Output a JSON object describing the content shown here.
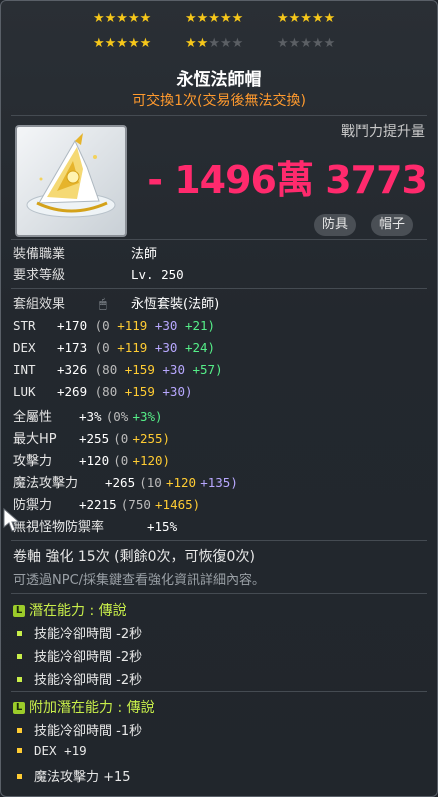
{
  "stars": {
    "groups": [
      {
        "on": 5,
        "off": 0
      },
      {
        "on": 5,
        "off": 0
      },
      {
        "on": 5,
        "off": 0
      },
      {
        "on": 5,
        "off": 0
      },
      {
        "on": 2,
        "off": 3
      },
      {
        "on": 0,
        "off": 5
      }
    ]
  },
  "item": {
    "name": "永恆法師帽",
    "trade_note": "可交換1次(交易後無法交換)",
    "cp_label": "戰鬥力提升量",
    "cp_value": "- 1496萬 3773",
    "tags": [
      "防具",
      "帽子"
    ]
  },
  "requirements": [
    {
      "label": "裝備職業",
      "value": "法師"
    },
    {
      "label": "要求等級",
      "value": "Lv. 250"
    }
  ],
  "set": {
    "label": "套組效果",
    "value": "永恆套裝(法師)"
  },
  "stats": [
    {
      "name": "STR",
      "total": "+170",
      "base": "(0",
      "scroll": "+119",
      "flame": "+30",
      "star": "+21)"
    },
    {
      "name": "DEX",
      "total": "+173",
      "base": "(0",
      "scroll": "+119",
      "flame": "+30",
      "star": "+24)"
    },
    {
      "name": "INT",
      "total": "+326",
      "base": "(80",
      "scroll": "+159",
      "flame": "+30",
      "star": "+57)"
    },
    {
      "name": "LUK",
      "total": "+269",
      "base": "(80",
      "scroll": "+159",
      "flame": "+30)",
      "star": ""
    }
  ],
  "stats2": [
    {
      "name": "全屬性",
      "total": "+3%",
      "base": "(0%",
      "a": "+3%)",
      "a_color": "g",
      "b": ""
    },
    {
      "name": "最大HP",
      "total": "+255",
      "base": "(0",
      "a": "+255)",
      "a_color": "y",
      "b": ""
    },
    {
      "name": "攻擊力",
      "total": "+120",
      "base": "(0",
      "a": "+120)",
      "a_color": "y",
      "b": ""
    },
    {
      "name": "魔法攻擊力",
      "total": "+265",
      "base": "(10",
      "a": "+120",
      "a_color": "y",
      "b": "+135)"
    },
    {
      "name": "防禦力",
      "total": "+2215",
      "base": "(750",
      "a": "+1465)",
      "a_color": "y",
      "b": ""
    },
    {
      "name": "無視怪物防禦率",
      "total": "+15%",
      "base": "",
      "a": "",
      "a_color": "y",
      "b": ""
    }
  ],
  "scroll_line": "卷軸 強化 15次 (剩餘0次，可恢復0次)",
  "hint_line": "可透過NPC/採集鍵查看強化資訊詳細內容。",
  "potential": {
    "header": "潛在能力 : 傳說",
    "badge": "L",
    "lines": [
      "技能冷卻時間 -2秒",
      "技能冷卻時間 -2秒",
      "技能冷卻時間 -2秒"
    ]
  },
  "bonus_potential": {
    "header": "附加潛在能力 : 傳說",
    "badge": "L",
    "lines": [
      "技能冷卻時間 -1秒",
      "DEX +19",
      "魔法攻擊力 +15"
    ]
  },
  "colors": {
    "accent": "#ff2a6d",
    "gold": "#ffcc33",
    "legend": "#c8ee4a",
    "orange": "#ff9a2e"
  }
}
